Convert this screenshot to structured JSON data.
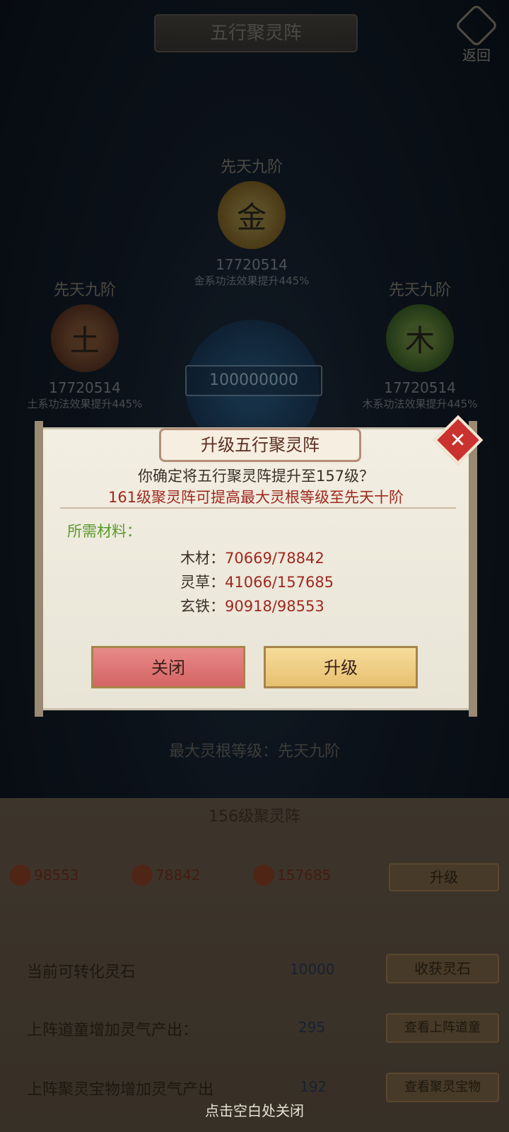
{
  "header": {
    "title": "五行聚灵阵",
    "back_label": "返回"
  },
  "elements": {
    "gold": {
      "rank": "先天九阶",
      "glyph": "金",
      "value": "17720514",
      "effect": "金系功法效果提升445%"
    },
    "earth": {
      "rank": "先天九阶",
      "glyph": "土",
      "value": "17720514",
      "effect": "土系功法效果提升445%"
    },
    "wood": {
      "rank": "先天九阶",
      "glyph": "木",
      "value": "17720514",
      "effect": "木系功法效果提升445%"
    }
  },
  "center": {
    "value": "100000000"
  },
  "max_root": "最大灵根等级：先天九阶",
  "bottom": {
    "level_title": "156级聚灵阵",
    "resources": [
      "98553",
      "78842",
      "157685"
    ],
    "upgrade_label": "升级",
    "rows": [
      {
        "label": "当前可转化灵石",
        "value": "10000",
        "button": "收获灵石"
      },
      {
        "label": "上阵道童增加灵气产出：",
        "value": "295",
        "button": "查看上阵道童"
      },
      {
        "label": "上阵聚灵宝物增加灵气产出",
        "value": "192",
        "button": "查看聚灵宝物"
      }
    ],
    "close_hint": "点击空白处关闭"
  },
  "dialog": {
    "title": "升级五行聚灵阵",
    "confirm": "你确定将五行聚灵阵提升至157级？",
    "notice": "161级聚灵阵可提高最大灵根等级至先天十阶",
    "materials_heading": "所需材料：",
    "materials": [
      {
        "name": "木材：",
        "amount": "70669/78842"
      },
      {
        "name": "灵草：",
        "amount": "41066/157685"
      },
      {
        "name": "玄铁：",
        "amount": "90918/98553"
      }
    ],
    "close_label": "关闭",
    "upgrade_label": "升级"
  }
}
